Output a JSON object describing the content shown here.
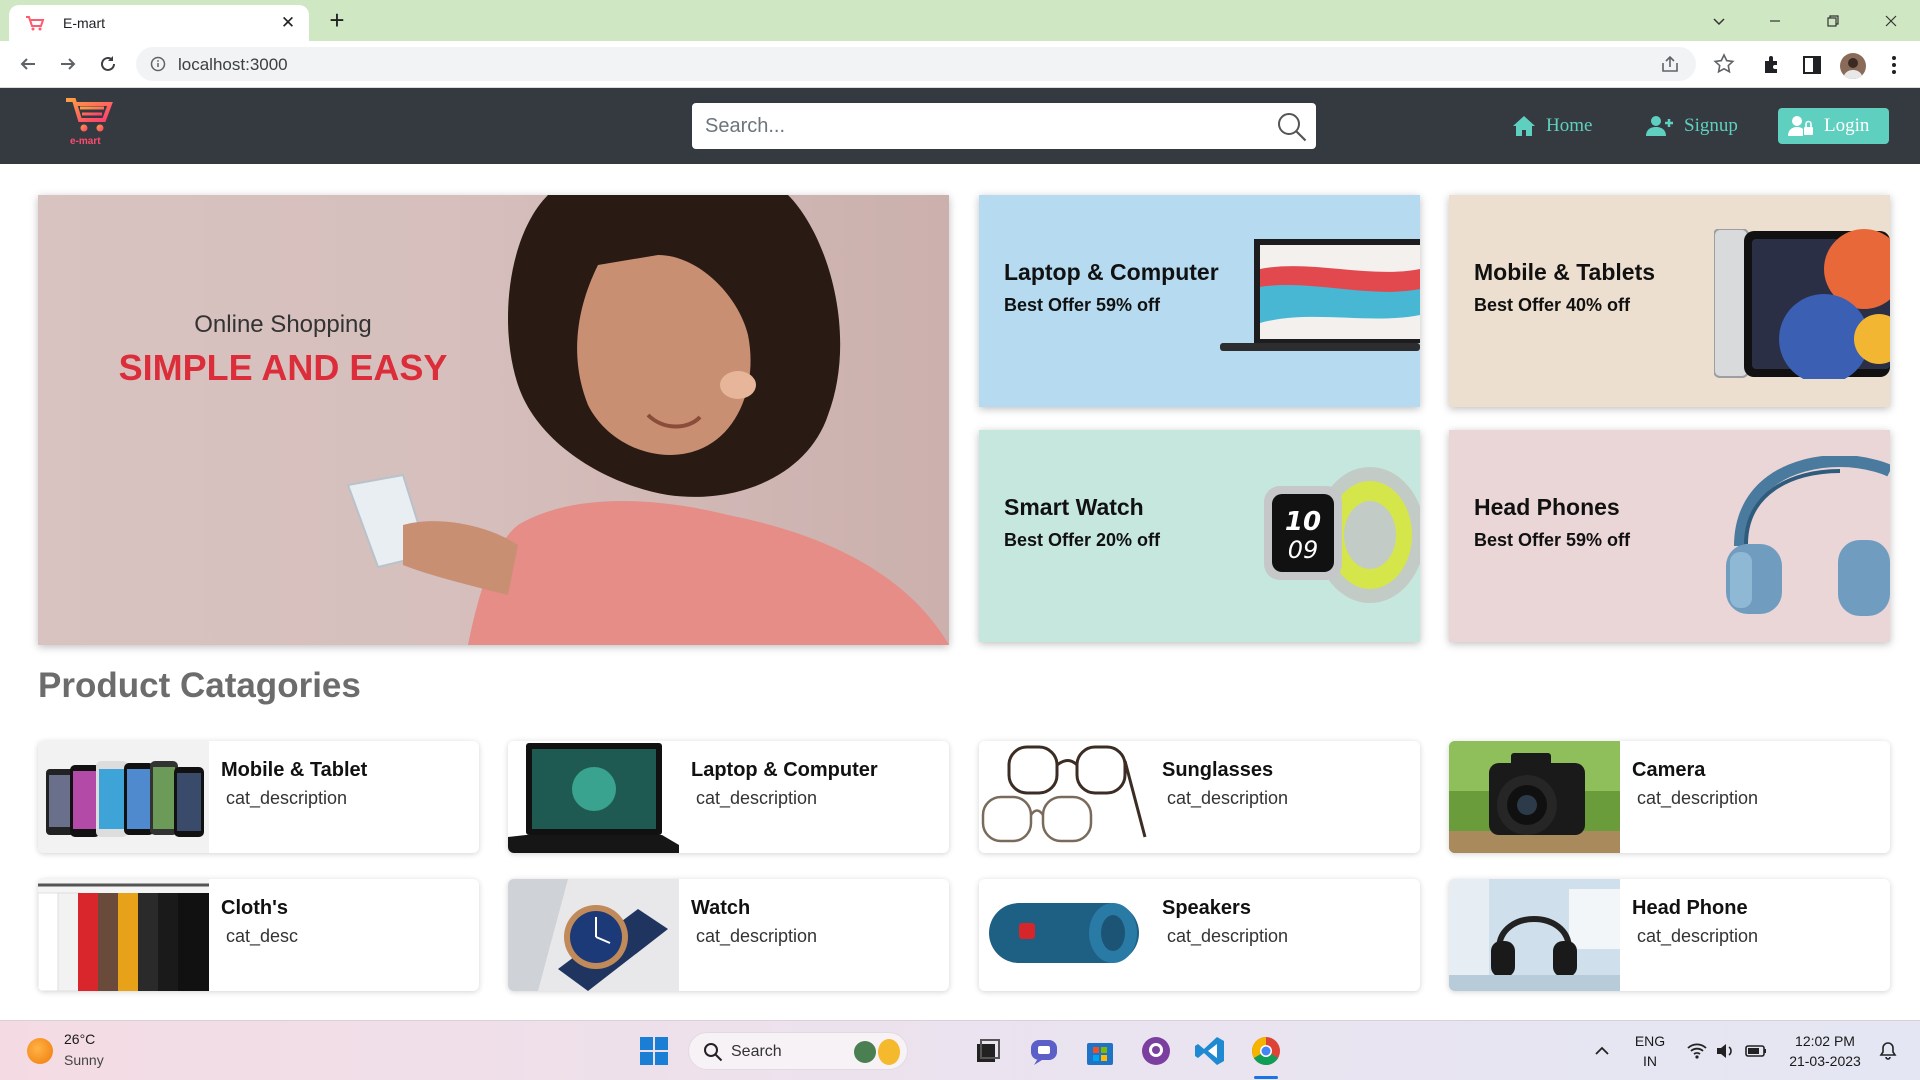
{
  "browser": {
    "tab_title": "E-mart",
    "tab_close": "✕",
    "new_tab": "+",
    "url": "localhost:3000"
  },
  "site": {
    "logo_text": "e-mart",
    "search_placeholder": "Search...",
    "nav": {
      "home": "Home",
      "signup": "Signup",
      "login": "Login"
    },
    "accent_color": "#5fd0bf",
    "header_color": "#343a40"
  },
  "hero": {
    "subtitle": "Online Shopping",
    "headline": "SIMPLE AND EASY"
  },
  "promos": [
    {
      "title": "Laptop & Computer",
      "offer": "Best Offer 59% off",
      "bg": "#b6dbf0"
    },
    {
      "title": "Mobile & Tablets",
      "offer": "Best Offer 40% off",
      "bg": "#ecdfcf"
    },
    {
      "title": "Smart Watch",
      "offer": "Best Offer 20% off",
      "bg": "#c6e7de"
    },
    {
      "title": "Head Phones",
      "offer": "Best Offer 59% off",
      "bg": "#ead6d6"
    }
  ],
  "categories_title": "Product Catagories",
  "categories": [
    {
      "name": "Mobile & Tablet",
      "desc": "cat_description"
    },
    {
      "name": "Laptop & Computer",
      "desc": "cat_description"
    },
    {
      "name": "Sunglasses",
      "desc": "cat_description"
    },
    {
      "name": "Camera",
      "desc": "cat_description"
    },
    {
      "name": "Cloth's",
      "desc": "cat_desc"
    },
    {
      "name": "Watch",
      "desc": "cat_description"
    },
    {
      "name": "Speakers",
      "desc": "cat_description"
    },
    {
      "name": "Head Phone",
      "desc": "cat_description"
    }
  ],
  "taskbar": {
    "temperature": "26°C",
    "condition": "Sunny",
    "search_label": "Search",
    "lang": "ENG",
    "region": "IN",
    "time": "12:02 PM",
    "date": "21-03-2023"
  }
}
